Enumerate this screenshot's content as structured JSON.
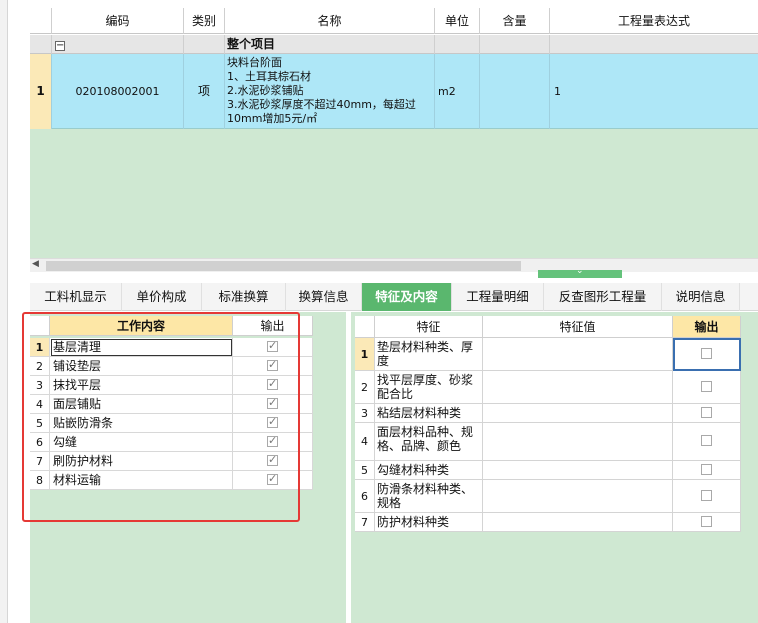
{
  "top_grid": {
    "headers": [
      "编码",
      "类别",
      "名称",
      "单位",
      "含量",
      "工程量表达式"
    ],
    "group_row": {
      "toggle": "−",
      "name": "整个项目"
    },
    "rows": [
      {
        "num": "1",
        "code": "020108002001",
        "category": "项",
        "name_lines": [
          "块料台阶面",
          "1、土耳其棕石材",
          "2.水泥砂浆铺贴",
          "3.水泥砂浆厚度不超过40mm，每超过",
          "10mm增加5元/㎡"
        ],
        "unit": "m2",
        "content": "",
        "expression": "1"
      }
    ]
  },
  "tabs": [
    {
      "label": "工料机显示"
    },
    {
      "label": "单价构成"
    },
    {
      "label": "标准换算"
    },
    {
      "label": "换算信息"
    },
    {
      "label": "特征及内容",
      "active": true
    },
    {
      "label": "工程量明细"
    },
    {
      "label": "反查图形工程量"
    },
    {
      "label": "说明信息"
    }
  ],
  "work_content": {
    "headers": {
      "content": "工作内容",
      "output": "输出"
    },
    "rows": [
      {
        "num": "1",
        "label": "基层清理",
        "checked": true
      },
      {
        "num": "2",
        "label": "铺设垫层",
        "checked": true
      },
      {
        "num": "3",
        "label": "抹找平层",
        "checked": true
      },
      {
        "num": "4",
        "label": "面层铺贴",
        "checked": true
      },
      {
        "num": "5",
        "label": "贴嵌防滑条",
        "checked": true
      },
      {
        "num": "6",
        "label": "勾缝",
        "checked": true
      },
      {
        "num": "7",
        "label": "刷防护材料",
        "checked": true
      },
      {
        "num": "8",
        "label": "材料运输",
        "checked": true
      }
    ]
  },
  "features": {
    "headers": {
      "feature": "特征",
      "value": "特征值",
      "output": "输出"
    },
    "rows": [
      {
        "num": "1",
        "lines": [
          "垫层材料种类、厚",
          "度"
        ],
        "value": "",
        "checked": false
      },
      {
        "num": "2",
        "lines": [
          "找平层厚度、砂浆",
          "配合比"
        ],
        "value": "",
        "checked": false
      },
      {
        "num": "3",
        "lines": [
          "粘结层材料种类"
        ],
        "value": "",
        "checked": false
      },
      {
        "num": "4",
        "lines": [
          "面层材料品种、规",
          "格、品牌、颜色"
        ],
        "value": "",
        "checked": false
      },
      {
        "num": "5",
        "lines": [
          "勾缝材料种类"
        ],
        "value": "",
        "checked": false
      },
      {
        "num": "6",
        "lines": [
          "防滑条材料种类、",
          "规格"
        ],
        "value": "",
        "checked": false
      },
      {
        "num": "7",
        "lines": [
          "防护材料种类"
        ],
        "value": "",
        "checked": false
      }
    ]
  },
  "colors": {
    "accent_green": "#5ab76e",
    "highlight_red": "#e53935",
    "selected_row": "#aee7f7"
  }
}
